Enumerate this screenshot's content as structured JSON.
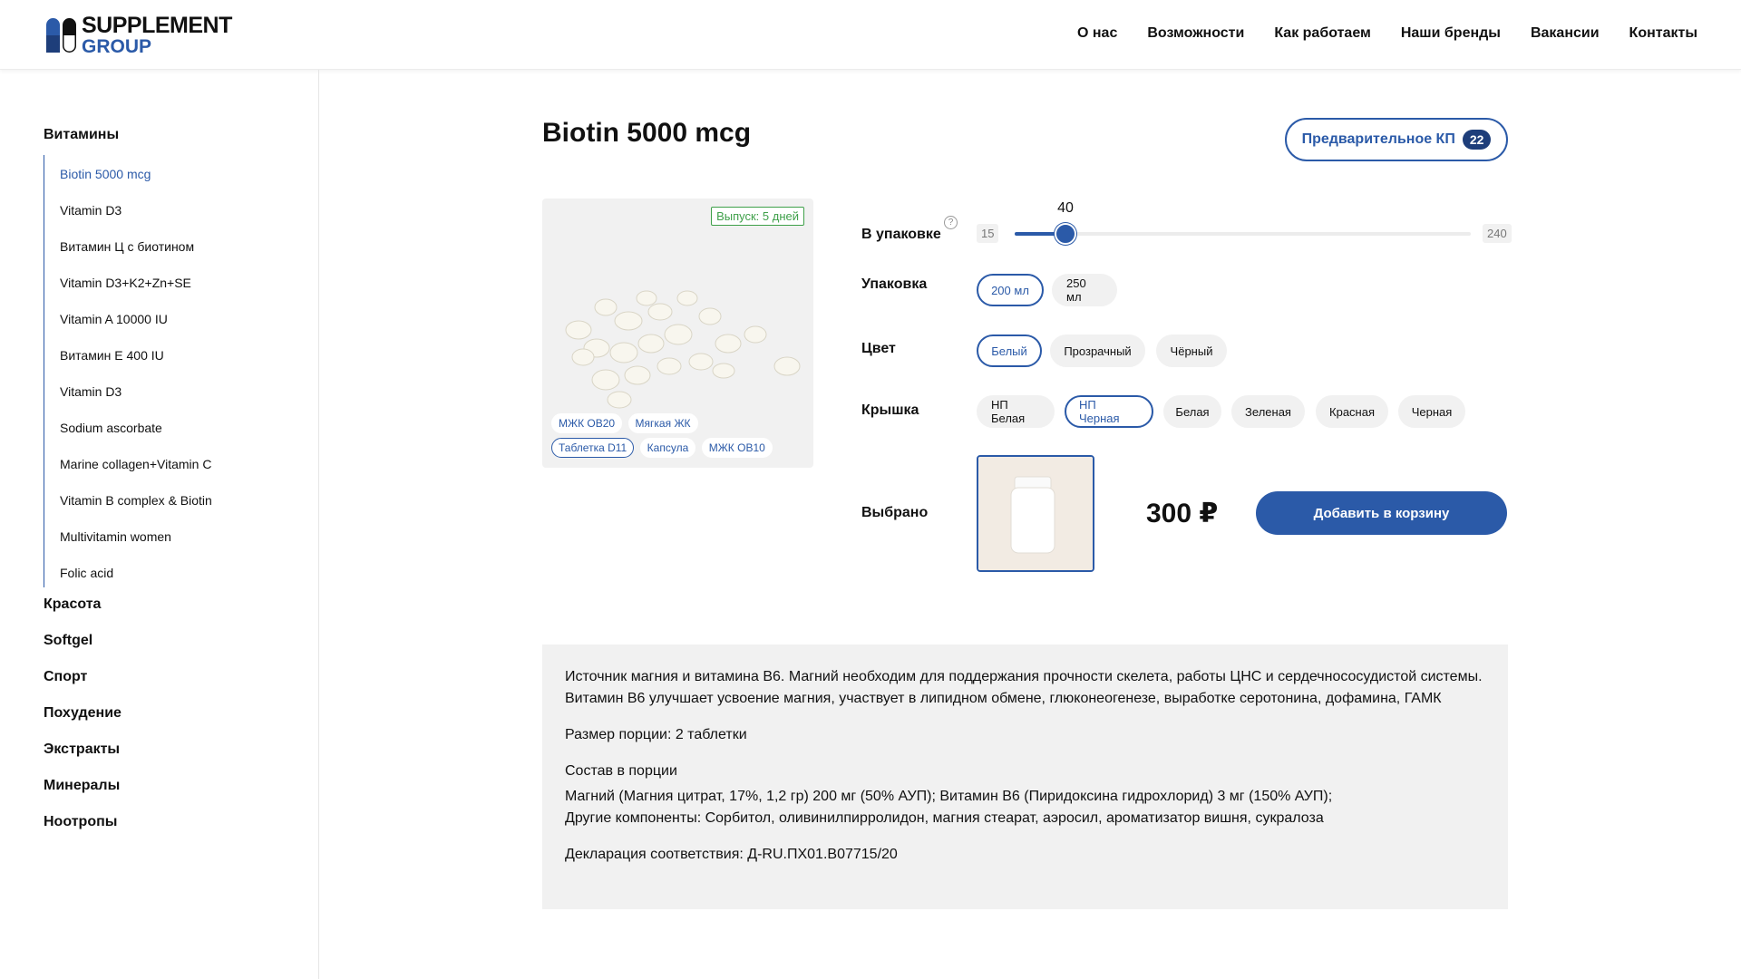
{
  "brand": {
    "line1": "SUPPLEMENT",
    "line2": "GROUP",
    "accent": "#2b5aa8"
  },
  "nav": [
    "О нас",
    "Возможности",
    "Как работаем",
    "Наши бренды",
    "Вакансии",
    "Контакты"
  ],
  "sidebar": {
    "categories": [
      "Витамины",
      "Красота",
      "Softgel",
      "Спорт",
      "Похудение",
      "Экстракты",
      "Минералы",
      "Ноотропы"
    ],
    "subitems": [
      "Biotin 5000 mcg",
      "Vitamin D3",
      "Витамин Ц с биотином",
      "Vitamin D3+K2+Zn+SE",
      "Vitamin A 10000 IU",
      "Витамин Е 400 IU",
      "Vitamin D3",
      "Sodium ascorbate",
      "Marine collagen+Vitamin C",
      "Vitamin B complex & Biotin",
      "Multivitamin women",
      "Folic acid"
    ],
    "active_subitem": "Biotin 5000 mcg"
  },
  "product": {
    "title": "Biotin 5000 mcg",
    "kp_label": "Предварительное КП",
    "kp_count": "22",
    "release": "Выпуск: 5 дней",
    "forms": [
      "МЖК OB20",
      "Мягкая ЖК",
      "Таблетка D11",
      "Капсула",
      "МЖК OB10"
    ],
    "selected_form": "Таблетка D11"
  },
  "options": {
    "per_pack": {
      "label": "В упаковке",
      "help": "?",
      "min": "15",
      "max": "240",
      "value": "40"
    },
    "package": {
      "label": "Упаковка",
      "values": [
        "200 мл",
        "250 мл"
      ],
      "selected": "200 мл"
    },
    "color": {
      "label": "Цвет",
      "values": [
        "Белый",
        "Прозрачный",
        "Чёрный"
      ],
      "selected": "Белый"
    },
    "lid": {
      "label": "Крышка",
      "values": [
        "НП Белая",
        "НП Черная",
        "Белая",
        "Зеленая",
        "Красная",
        "Черная"
      ],
      "selected": "НП Черная"
    },
    "chosen": {
      "label": "Выбрано"
    }
  },
  "price": "300 ₽",
  "cart_button": "Добавить в корзину",
  "description": {
    "intro": "Источник магния и витамина B6. Магний необходим для поддержания прочности скелета, работы ЦНС и сердечнососудистой системы. Витамин В6 улучшает усвоение магния, участвует в липидном обмене, глюконеогенезе, выработке серотонина, дофамина, ГАМК",
    "serving": "Размер порции: 2 таблетки",
    "composition_title": "Состав в порции",
    "composition_line1": "Магний (Магния цитрат, 17%, 1,2 гр) 200 мг (50% АУП); Витамин В6 (Пиридоксина гидрохлорид) 3 мг (150% АУП);",
    "composition_line2": "Другие компоненты: Сорбитол, оливинилпирролидон, магния стеарат, аэросил, ароматизатор вишня, сукралоза",
    "declaration": "Декларация соответствия: Д-RU.ПХ01.В07715/20"
  }
}
